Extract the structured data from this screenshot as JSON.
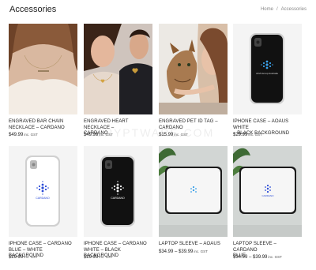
{
  "page": {
    "title": "Accessories",
    "breadcrumb": [
      "Home",
      "/",
      "Accessories"
    ]
  },
  "watermark": "CRYPTWARE.COM",
  "products": [
    {
      "name_lines": [
        "ENGRAVED BAR CHAIN",
        "NECKLACE – CARDANO"
      ],
      "price": "$49.99",
      "unit": "inc. GST",
      "image": "necklace-bar-photo"
    },
    {
      "name_lines": [
        "ENGRAVED HEART NECKLACE –",
        "CARDANO"
      ],
      "price": "$49.99",
      "unit": "inc. GST",
      "image": "necklace-heart-photo"
    },
    {
      "name_lines": [
        "ENGRAVED PET ID TAG –",
        "CARDANO"
      ],
      "price": "$15.99",
      "unit": "inc. GST",
      "image": "pet-tag-photo"
    },
    {
      "name_lines": [
        "IPHONE CASE – AOAUS WHITE",
        "– BLACK BACKGROUND"
      ],
      "price": "$29.99",
      "unit": "inc. GST",
      "image": "phone-case-black"
    },
    {
      "name_lines": [
        "IPHONE CASE – CARDANO",
        "BLUE – WHITE BACKGROUND"
      ],
      "price": "$29.99",
      "unit": "inc. GST",
      "image": "phone-case-white"
    },
    {
      "name_lines": [
        "IPHONE CASE – CARDANO",
        "WHITE – BLACK BACKGROUND"
      ],
      "price": "$29.99",
      "unit": "inc. GST",
      "image": "phone-case-black-cardano"
    },
    {
      "name_lines": [
        "LAPTOP SLEEVE – AOAUS"
      ],
      "price": "$34.99 – $39.99",
      "unit": "inc. GST",
      "image": "laptop-sleeve-aoaus"
    },
    {
      "name_lines": [
        "LAPTOP SLEEVE – CARDANO",
        "BLUE"
      ],
      "price": "$34.99 – $39.99",
      "unit": "inc. GST",
      "image": "laptop-sleeve-cardano"
    }
  ],
  "labels": {
    "aoaus_case": "AOA Group Australia",
    "cardano": "CARDANO"
  },
  "colors": {
    "cardano_blue": "#2a4bd7",
    "case_black": "#111111",
    "sleeve_trim": "#1a1a1a"
  }
}
